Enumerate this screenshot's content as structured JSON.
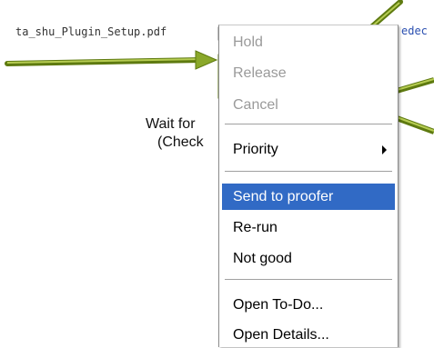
{
  "background_label": "ta_shu_Plugin_Setup.pdf",
  "edge_label": "edec",
  "node_label": [
    "Wait for",
    "(Check"
  ],
  "colors": {
    "connector": "#8aa82a",
    "connector_dark": "#5e7a10",
    "selection": "#316ac5",
    "disabled_text": "#9a9a9a"
  },
  "context_menu": {
    "items": [
      {
        "label": "Hold",
        "state": "disabled"
      },
      {
        "label": "Release",
        "state": "disabled"
      },
      {
        "label": "Cancel",
        "state": "disabled"
      },
      {
        "label": "Priority",
        "state": "normal",
        "submenu": true
      },
      {
        "label": "Send to proofer",
        "state": "selected"
      },
      {
        "label": "Re-run",
        "state": "normal"
      },
      {
        "label": "Not good",
        "state": "normal"
      },
      {
        "label": "Open To-Do...",
        "state": "normal"
      },
      {
        "label": "Open Details...",
        "state": "normal"
      }
    ]
  }
}
